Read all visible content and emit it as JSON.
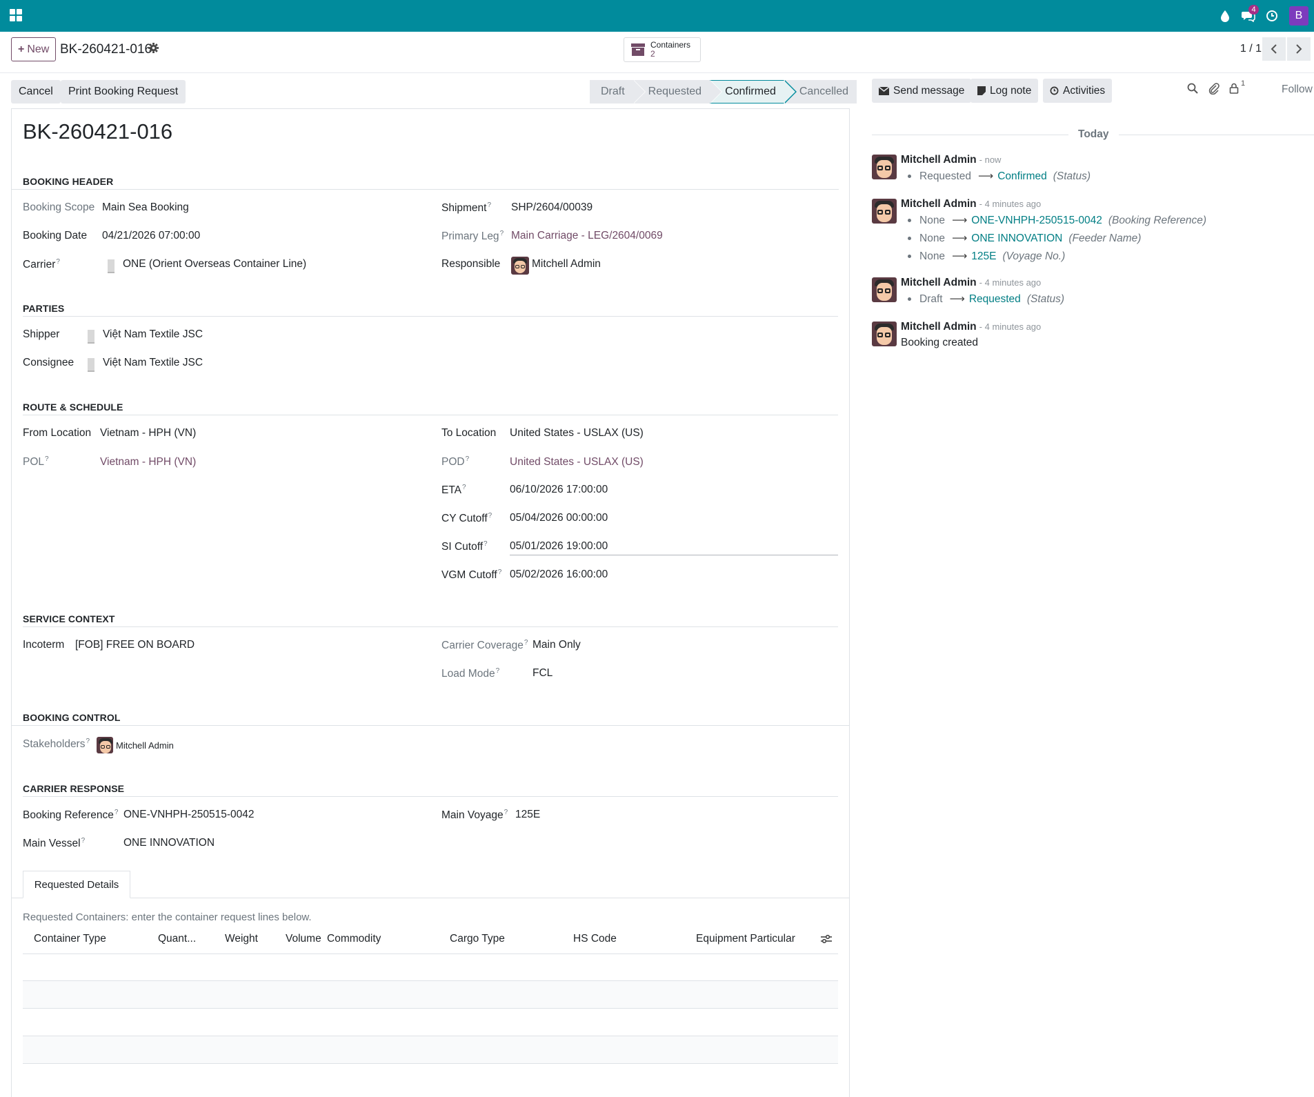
{
  "topbar": {
    "chat_badge": "4",
    "user_initial": "B",
    "colors": {
      "brand": "#018b9c",
      "accent": "#714b67",
      "avatar": "#7c3bbd"
    }
  },
  "control": {
    "new_label": "New",
    "record_title": "BK-260421-016",
    "smart_button": {
      "label": "Containers",
      "count": "2"
    },
    "pager": "1 / 1"
  },
  "actions": {
    "cancel": "Cancel",
    "print": "Print Booking Request"
  },
  "statusbar": [
    "Draft",
    "Requested",
    "Confirmed",
    "Cancelled"
  ],
  "statusbar_active": "Confirmed",
  "form": {
    "title": "BK-260421-016",
    "booking_header": {
      "section": "BOOKING HEADER",
      "booking_scope_label": "Booking Scope",
      "booking_scope": "Main Sea Booking",
      "booking_date_label": "Booking Date",
      "booking_date": "04/21/2026 07:00:00",
      "carrier_label": "Carrier",
      "carrier": "ONE (Orient Overseas Container Line)",
      "shipment_label": "Shipment",
      "shipment": "SHP/2604/00039",
      "primary_leg_label": "Primary Leg",
      "primary_leg": "Main Carriage - LEG/2604/0069",
      "responsible_label": "Responsible",
      "responsible": "Mitchell Admin"
    },
    "parties": {
      "section": "PARTIES",
      "shipper_label": "Shipper",
      "shipper": "Việt Nam Textile JSC",
      "consignee_label": "Consignee",
      "consignee": "Việt Nam Textile JSC"
    },
    "route": {
      "section": "ROUTE & SCHEDULE",
      "from_label": "From Location",
      "from": "Vietnam - HPH (VN)",
      "pol_label": "POL",
      "pol": "Vietnam - HPH (VN)",
      "to_label": "To Location",
      "to": "United States - USLAX (US)",
      "pod_label": "POD",
      "pod": "United States - USLAX (US)",
      "eta_label": "ETA",
      "eta": "06/10/2026 17:00:00",
      "cy_label": "CY Cutoff",
      "cy": "05/04/2026 00:00:00",
      "si_label": "SI Cutoff",
      "si": "05/01/2026 19:00:00",
      "vgm_label": "VGM Cutoff",
      "vgm": "05/02/2026 16:00:00"
    },
    "service": {
      "section": "SERVICE CONTEXT",
      "incoterm_label": "Incoterm",
      "incoterm": "[FOB] FREE ON BOARD",
      "coverage_label": "Carrier Coverage",
      "coverage": "Main Only",
      "load_label": "Load Mode",
      "load": "FCL"
    },
    "control": {
      "section": "BOOKING CONTROL",
      "stakeholders_label": "Stakeholders",
      "stakeholder": "Mitchell Admin"
    },
    "carrier_response": {
      "section": "CARRIER RESPONSE",
      "booking_ref_label": "Booking Reference",
      "booking_ref": "ONE-VNHPH-250515-0042",
      "vessel_label": "Main Vessel",
      "vessel": "ONE INNOVATION",
      "voyage_label": "Main Voyage",
      "voyage": "125E"
    },
    "tab": "Requested Details",
    "hint": "Requested Containers: enter the container request lines below.",
    "columns": [
      "Container Type",
      "Quant...",
      "Weight",
      "Volume",
      "Commodity",
      "Cargo Type",
      "HS Code",
      "Equipment Particular"
    ]
  },
  "chatter": {
    "send_message": "Send message",
    "log_note": "Log note",
    "activities": "Activities",
    "followers_count": "1",
    "follow": "Follow",
    "today": "Today",
    "messages": [
      {
        "author": "Mitchell Admin",
        "when": "- now",
        "changes": [
          {
            "old": "Requested",
            "new": "Confirmed",
            "field": "(Status)"
          }
        ]
      },
      {
        "author": "Mitchell Admin",
        "when": "- 4 minutes ago",
        "changes": [
          {
            "old": "None",
            "new": "ONE-VNHPH-250515-0042",
            "field": "(Booking Reference)"
          },
          {
            "old": "None",
            "new": "ONE INNOVATION",
            "field": "(Feeder Name)"
          },
          {
            "old": "None",
            "new": "125E",
            "field": "(Voyage No.)"
          }
        ]
      },
      {
        "author": "Mitchell Admin",
        "when": "- 4 minutes ago",
        "changes": [
          {
            "old": "Draft",
            "new": "Requested",
            "field": "(Status)"
          }
        ]
      },
      {
        "author": "Mitchell Admin",
        "when": "- 4 minutes ago",
        "body": "Booking created"
      }
    ]
  }
}
